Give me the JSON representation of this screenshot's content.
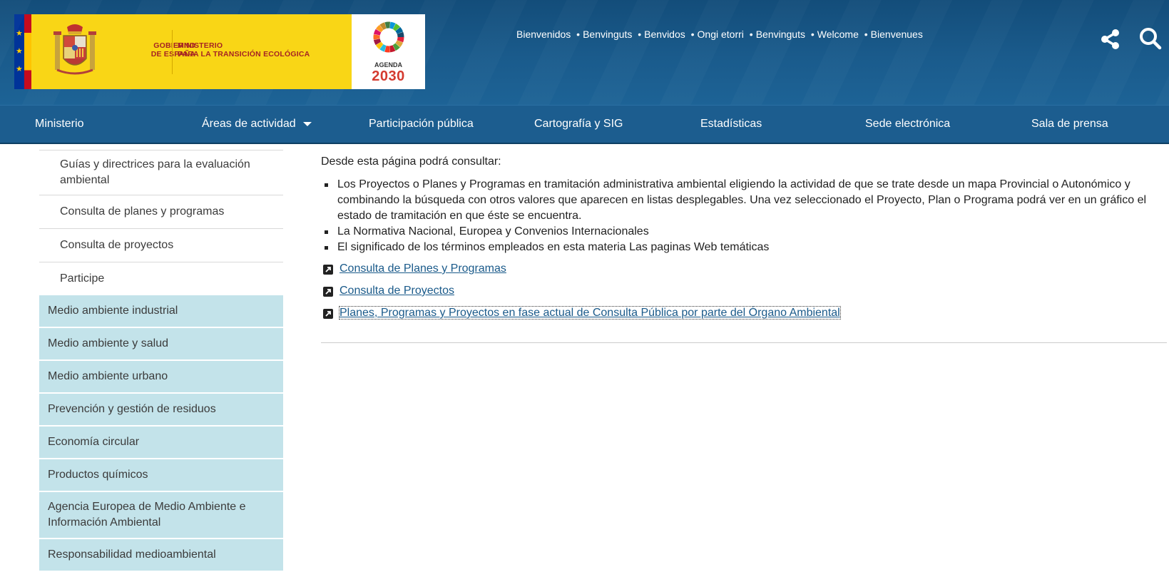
{
  "header": {
    "government_line1": "GOBIERNO",
    "government_line2": "DE ESPAÑA",
    "ministry_line1": "MINISTERIO",
    "ministry_line2": "PARA LA TRANSICIÓN ECOLÓGICA",
    "agenda_label": "AGENDA",
    "agenda_year": "2030",
    "languages": [
      "Bienvenidos",
      "Benvinguts",
      "Benvidos",
      "Ongi etorri",
      "Benvinguts",
      "Welcome",
      "Bienvenues"
    ],
    "language_separator": "•",
    "icons": {
      "share": "share-icon",
      "search": "search-icon"
    }
  },
  "nav": {
    "items": [
      {
        "label": "Ministerio"
      },
      {
        "label": "Áreas de actividad",
        "dropdown": true
      },
      {
        "label": "Participación pública"
      },
      {
        "label": "Cartografía y SIG"
      },
      {
        "label": "Estadísticas"
      },
      {
        "label": "Sede electrónica"
      },
      {
        "label": "Sala de prensa"
      }
    ]
  },
  "sidebar": {
    "subitems": [
      {
        "label": "Guías y directrices para la evaluación ambiental"
      },
      {
        "label": "Consulta de planes y programas"
      },
      {
        "label": "Consulta de proyectos"
      },
      {
        "label": "Participe"
      }
    ],
    "items": [
      {
        "label": "Medio ambiente industrial"
      },
      {
        "label": "Medio ambiente y salud"
      },
      {
        "label": "Medio ambiente urbano"
      },
      {
        "label": "Prevención y gestión de residuos"
      },
      {
        "label": "Economía circular"
      },
      {
        "label": "Productos químicos"
      },
      {
        "label": "Agencia Europea de Medio Ambiente e Información Ambiental"
      },
      {
        "label": "Responsabilidad medioambiental"
      }
    ]
  },
  "content": {
    "intro": "Desde esta página podrá consultar:",
    "bullets": [
      "Los Proyectos o Planes y Programas en tramitación administrativa ambiental eligiendo la actividad de que se trate desde un mapa Provincial o Autonómico y combinando la búsqueda con otros valores que aparecen en listas desplegables. Una vez seleccionado el Proyecto, Plan o Programa podrá ver en un gráfico el estado de tramitación en que éste se encuentra.",
      "La Normativa Nacional, Europea y Convenios Internacionales",
      "El significado de los términos empleados en esta materia Las paginas Web temáticas"
    ],
    "links": [
      {
        "label": "Consulta de Planes y Programas"
      },
      {
        "label": "Consulta de Proyectos"
      },
      {
        "label": "Planes, Programas y Proyectos en fase actual de Consulta Pública por parte del Órgano Ambiental"
      }
    ]
  },
  "colors": {
    "header_blue": "#1a5b8c",
    "nav_blue": "#1c5d8f",
    "gov_yellow": "#f9d616",
    "sidebar_teal": "#c3e3ea",
    "link_blue": "#1a5a8a"
  }
}
